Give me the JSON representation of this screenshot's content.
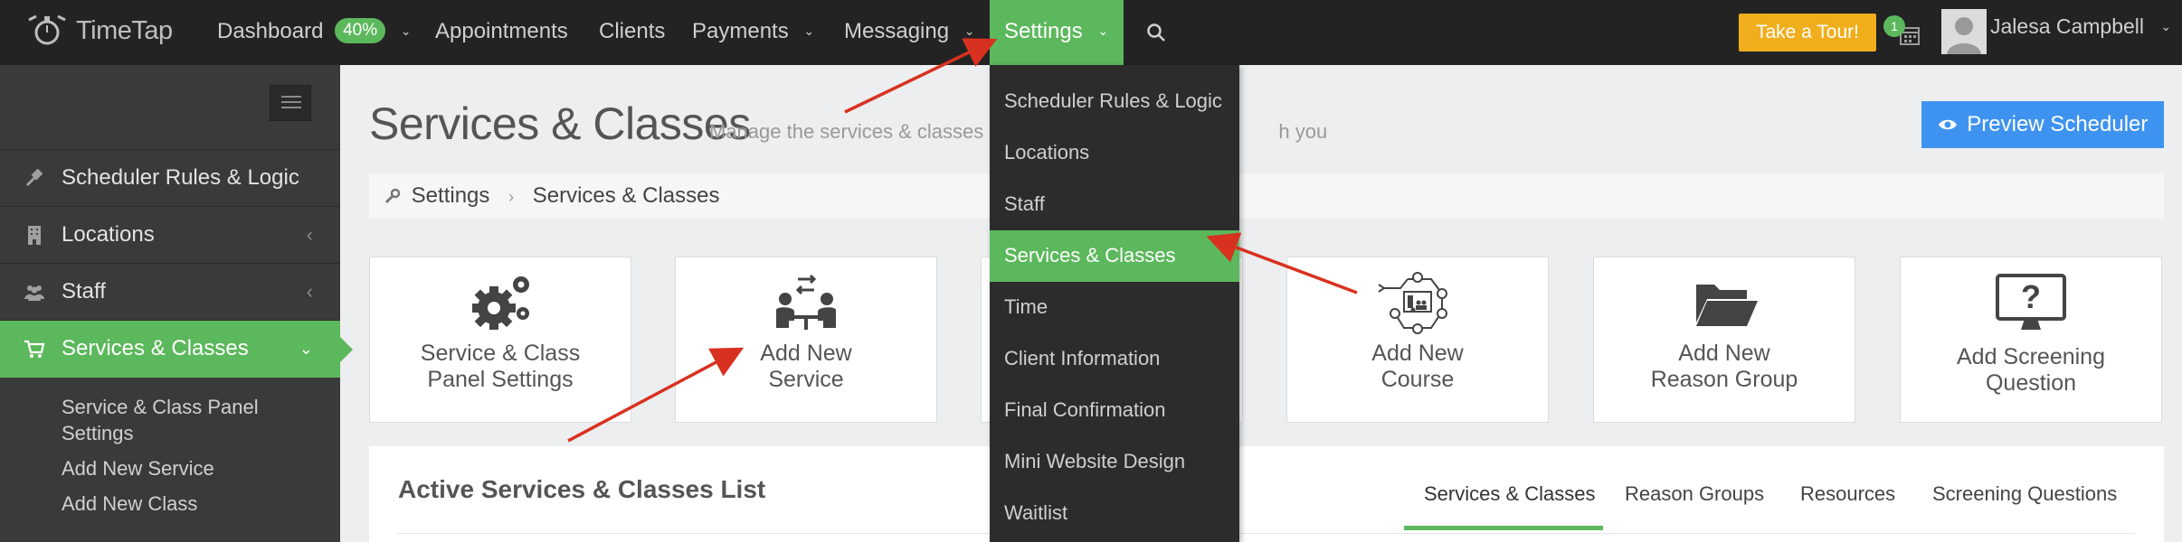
{
  "app": {
    "logo_text": "TimeTap"
  },
  "topnav": {
    "dashboard_label": "Dashboard",
    "dashboard_progress": "40%",
    "appointments_label": "Appointments",
    "clients_label": "Clients",
    "payments_label": "Payments",
    "messaging_label": "Messaging",
    "settings_label": "Settings",
    "tour_label": "Take a Tour!",
    "calendar_badge": "1",
    "user_name": "Jalesa Campbell"
  },
  "settings_menu": {
    "items": [
      {
        "label": "Scheduler Rules & Logic"
      },
      {
        "label": "Locations"
      },
      {
        "label": "Staff"
      },
      {
        "label": "Services & Classes"
      },
      {
        "label": "Time"
      },
      {
        "label": "Client Information"
      },
      {
        "label": "Final Confirmation"
      },
      {
        "label": "Mini Website Design"
      },
      {
        "label": "Waitlist"
      }
    ],
    "active_index": 3
  },
  "sidebar": {
    "items": [
      {
        "label": "Scheduler Rules & Logic",
        "icon": "gavel-icon"
      },
      {
        "label": "Locations",
        "icon": "building-icon"
      },
      {
        "label": "Staff",
        "icon": "users-icon"
      },
      {
        "label": "Services & Classes",
        "icon": "cart-icon"
      }
    ],
    "subitems": [
      {
        "label": "Service & Class Panel Settings"
      },
      {
        "label": "Add New Service"
      },
      {
        "label": "Add New Class"
      }
    ]
  },
  "main": {
    "title": "Services & Classes",
    "subtitle": "Manage the services & classes ",
    "subtitle_tail": "h you",
    "preview_label": "Preview Scheduler",
    "breadcrumb": {
      "root": "Settings",
      "current": "Services & Classes"
    },
    "cards": [
      {
        "line1": "Service & Class",
        "line2": "Panel Settings",
        "icon": "gears-icon"
      },
      {
        "line1": "Add New",
        "line2": "Service",
        "icon": "meeting-icon"
      },
      {
        "line1": "Add New",
        "line2": "Course",
        "icon": "course-network-icon"
      },
      {
        "line1": "Add New",
        "line2": "Reason Group",
        "icon": "folder-open-icon"
      },
      {
        "line1": "Add Screening",
        "line2": "Question",
        "icon": "monitor-question-icon"
      }
    ],
    "list": {
      "title": "Active Services & Classes List",
      "tabs": [
        {
          "label": "Services & Classes"
        },
        {
          "label": "Reason Groups"
        },
        {
          "label": "Resources"
        },
        {
          "label": "Screening Questions"
        }
      ]
    }
  },
  "colors": {
    "accent_green": "#5cb85c",
    "topbar": "#232323",
    "tour_orange": "#f0ad1c",
    "preview_blue": "#3f93f0",
    "annotation_red": "#d9311f"
  }
}
